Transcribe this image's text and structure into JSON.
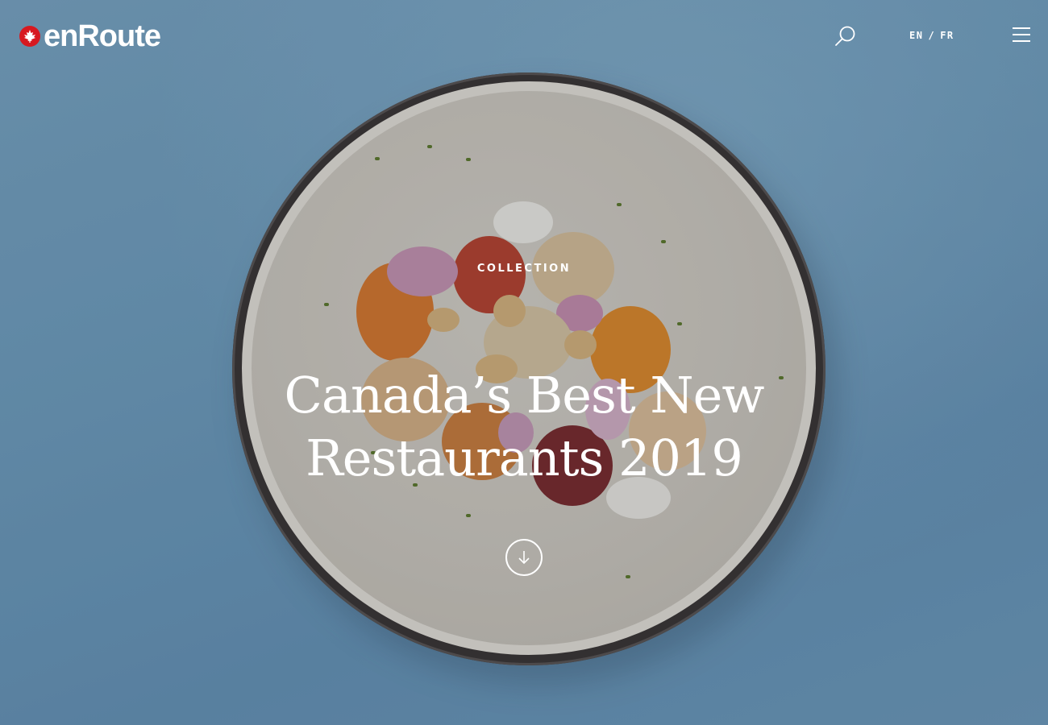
{
  "header": {
    "logo_text": "enRoute",
    "logo_icon": "maple-leaf-icon",
    "search_icon": "search-icon",
    "languages": {
      "en": "EN",
      "separator": "/",
      "fr": "FR"
    },
    "menu_icon": "hamburger-menu-icon"
  },
  "hero": {
    "eyebrow": "COLLECTION",
    "title_line1": "Canada’s Best New",
    "title_line2": "Restaurants 2019",
    "scroll_icon": "arrow-down-icon"
  },
  "colors": {
    "background": "#6f9fc0",
    "brand_red": "#d71920",
    "text": "#ffffff"
  }
}
